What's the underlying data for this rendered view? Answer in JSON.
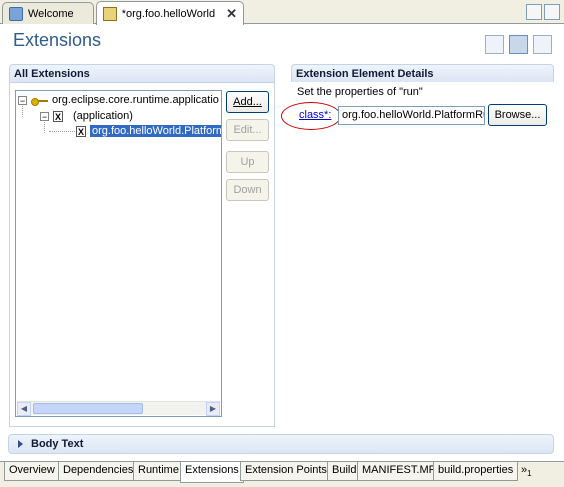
{
  "editor_tabs": {
    "welcome": "Welcome",
    "active": "*org.foo.helloWorld"
  },
  "form": {
    "title": "Extensions"
  },
  "all_extensions": {
    "heading": "All Extensions",
    "tree": {
      "extension": "org.eclipse.core.runtime.applicatio",
      "element": "(application)",
      "child": "org.foo.helloWorld.Platform"
    },
    "buttons": {
      "add": "Add...",
      "edit": "Edit...",
      "up": "Up",
      "down": "Down"
    }
  },
  "details": {
    "heading": "Extension Element Details",
    "description": "Set the properties of \"run\"",
    "class_label": "class*:",
    "class_value": "org.foo.helloWorld.PlatformRu",
    "browse": "Browse..."
  },
  "body_text": {
    "heading": "Body Text"
  },
  "page_tabs": [
    "Overview",
    "Dependencies",
    "Runtime",
    "Extensions",
    "Extension Points",
    "Build",
    "MANIFEST.MF",
    "build.properties"
  ],
  "page_tabs_active": "Extensions",
  "overflow_count": "1",
  "colors": {
    "title": "#2f5b8d",
    "selection": "#316ac5",
    "highlight_circle": "#d00000"
  }
}
